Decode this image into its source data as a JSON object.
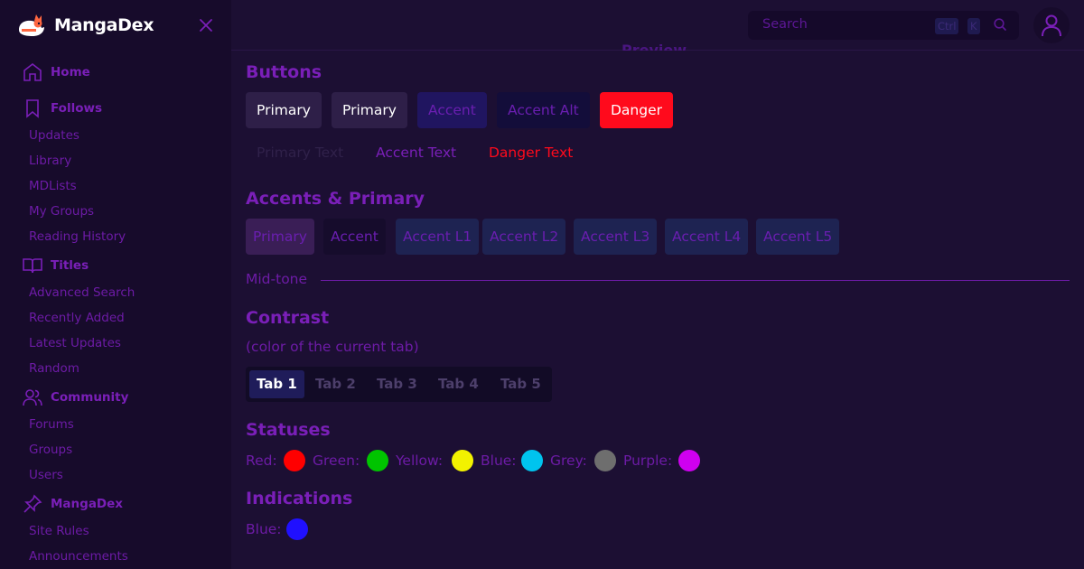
{
  "sidebar": {
    "brand": "MangaDex",
    "sections": [
      {
        "label": "Home",
        "icon": "home-icon",
        "items": []
      },
      {
        "label": "Follows",
        "icon": "bookmark-icon",
        "items": [
          "Updates",
          "Library",
          "MDLists",
          "My Groups",
          "Reading History"
        ]
      },
      {
        "label": "Titles",
        "icon": "book-open-icon",
        "items": [
          "Advanced Search",
          "Recently Added",
          "Latest Updates",
          "Random"
        ]
      },
      {
        "label": "Community",
        "icon": "users-icon",
        "items": [
          "Forums",
          "Groups",
          "Users"
        ]
      },
      {
        "label": "MangaDex",
        "icon": "pin-icon",
        "items": [
          "Site Rules",
          "Announcements"
        ]
      }
    ]
  },
  "header": {
    "search_placeholder": "Search",
    "shortcut_ctrl": "Ctrl",
    "shortcut_key": "K",
    "section_peek": "Preview"
  },
  "main": {
    "buttons_title": "Buttons",
    "buttons": [
      "Primary",
      "Primary",
      "Accent",
      "Accent Alt",
      "Danger"
    ],
    "text_buttons": [
      "Primary Text",
      "Accent Text",
      "Danger Text"
    ],
    "accents_title": "Accents & Primary",
    "accents": [
      "Primary",
      "Accent",
      "Accent L1",
      "Accent L2",
      "Accent L3",
      "Accent L4",
      "Accent L5"
    ],
    "midtone_label": "Mid-tone",
    "contrast_title": "Contrast",
    "contrast_note": "(color of the current tab)",
    "tabs": [
      "Tab 1",
      "Tab 2",
      "Tab 3",
      "Tab 4",
      "Tab 5"
    ],
    "active_tab": "Tab 1",
    "statuses_title": "Statuses",
    "statuses": [
      {
        "label": "Red:",
        "color": "#ff0000"
      },
      {
        "label": "Green:",
        "color": "#00c400"
      },
      {
        "label": "Yellow:",
        "color": "#f2f200"
      },
      {
        "label": "Blue:",
        "color": "#00c4ee"
      },
      {
        "label": "Grey:",
        "color": "#6e6e6e"
      },
      {
        "label": "Purple:",
        "color": "#cf00f0"
      }
    ],
    "indications_title": "Indications",
    "indications": [
      {
        "label": "Blue:",
        "color": "#2010ff"
      }
    ]
  },
  "colors": {
    "background": "#1c0f33",
    "sidebar": "#170b2b",
    "accent_purple": "#7a1fb8",
    "danger": "#ff0a1c",
    "white": "#ffffff"
  }
}
